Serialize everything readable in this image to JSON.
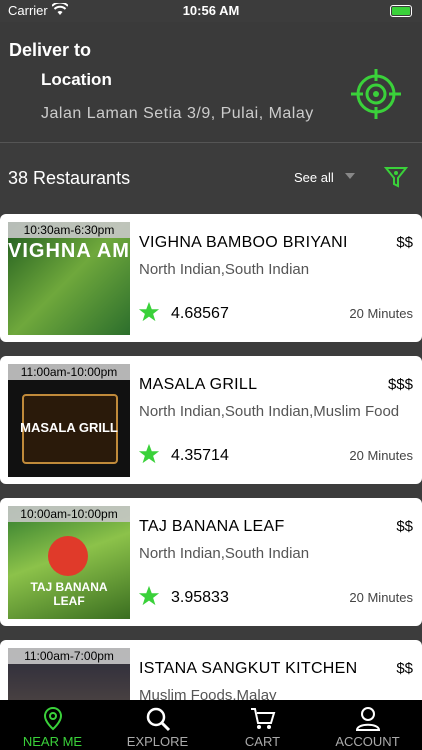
{
  "status_bar": {
    "carrier": "Carrier",
    "time": "10:56 AM"
  },
  "header": {
    "deliver_to": "Deliver to",
    "location_label": "Location",
    "address": "Jalan Laman Setia 3/9, Pulai, Malay"
  },
  "list_header": {
    "count": "38 Restaurants",
    "see_all": "See all"
  },
  "restaurants": [
    {
      "hours": "10:30am-6:30pm",
      "name": "VIGHNA BAMBOO BRIYANI",
      "price": "$$",
      "cuisine": "North Indian,South Indian",
      "rating": "4.68567",
      "time": "20 Minutes",
      "thumb_text": "VIGHNA AMBOO BRIYAN"
    },
    {
      "hours": "11:00am-10:00pm",
      "name": "MASALA GRILL",
      "price": "$$$",
      "cuisine": "North Indian,South Indian,Muslim Food",
      "rating": "4.35714",
      "time": "20 Minutes",
      "thumb_text": "MASALA GRILL"
    },
    {
      "hours": "10:00am-10:00pm",
      "name": "TAJ BANANA LEAF",
      "price": "$$",
      "cuisine": "North Indian,South Indian",
      "rating": "3.95833",
      "time": "20 Minutes",
      "thumb_text": "TAJ BANANA LEAF"
    },
    {
      "hours": "11:00am-7:00pm",
      "name": "ISTANA SANGKUT KITCHEN",
      "price": "$$",
      "cuisine": "Muslim Foods,Malay",
      "rating": "",
      "time": "",
      "thumb_text": ""
    }
  ],
  "tabs": [
    {
      "label": "NEAR ME",
      "icon": "location-pin-icon",
      "active": true
    },
    {
      "label": "EXPLORE",
      "icon": "search-icon",
      "active": false
    },
    {
      "label": "CART",
      "icon": "cart-icon",
      "active": false
    },
    {
      "label": "ACCOUNT",
      "icon": "user-icon",
      "active": false
    }
  ],
  "colors": {
    "accent": "#3ad13a",
    "background": "#3c3c3c",
    "tabbar": "#000000"
  }
}
